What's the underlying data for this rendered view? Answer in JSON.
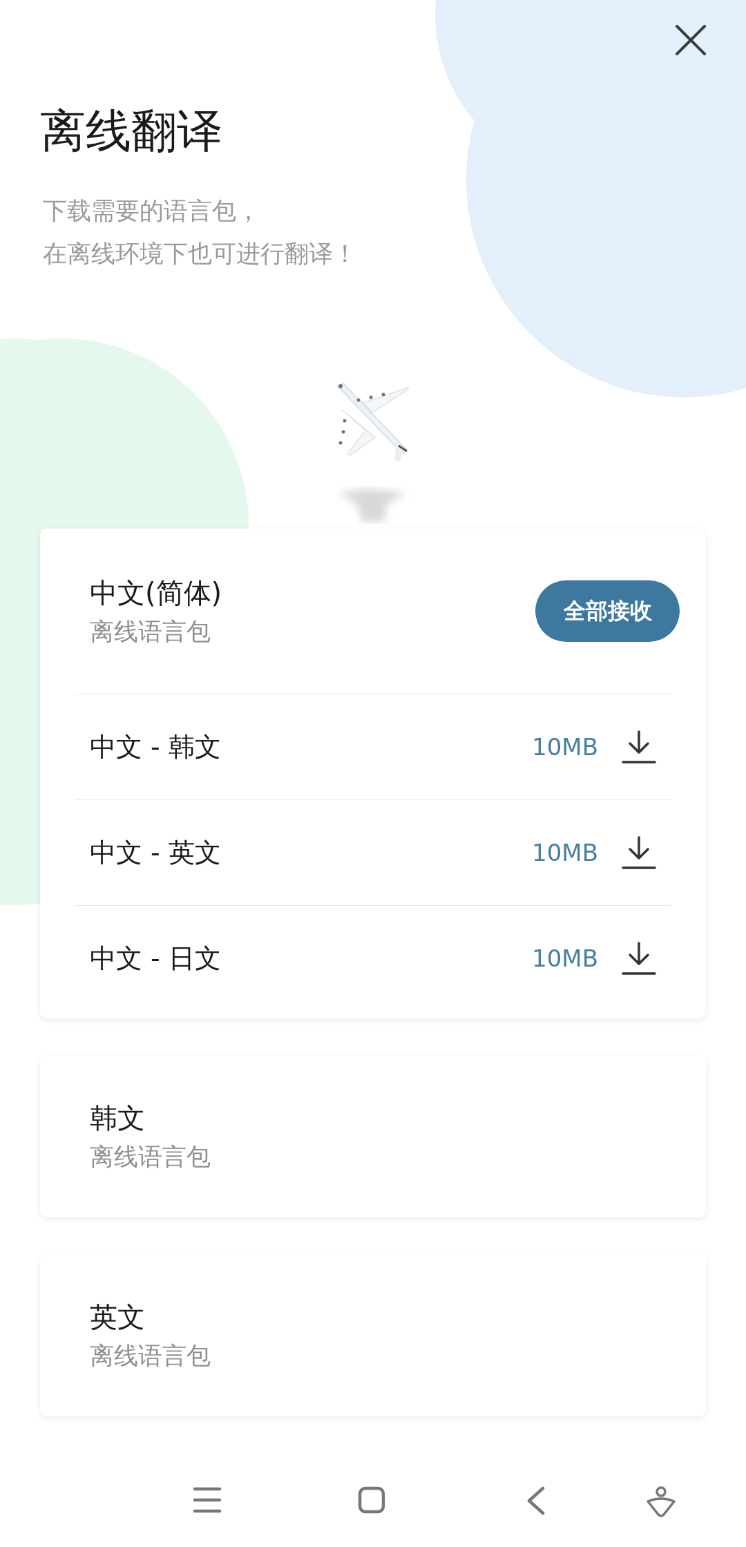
{
  "title": "离线翻译",
  "subtitle_lines": [
    "下载需要的语言包，",
    "在离线环境下也可进行翻译！"
  ],
  "packages": [
    {
      "name": "中文(简体)",
      "caption": "离线语言包",
      "action": "全部接收",
      "pairs": [
        {
          "name": "中文 - 韩文",
          "size": "10MB"
        },
        {
          "name": "中文 - 英文",
          "size": "10MB"
        },
        {
          "name": "中文 - 日文",
          "size": "10MB"
        }
      ]
    },
    {
      "name": "韩文",
      "caption": "离线语言包"
    },
    {
      "name": "英文",
      "caption": "离线语言包"
    }
  ]
}
